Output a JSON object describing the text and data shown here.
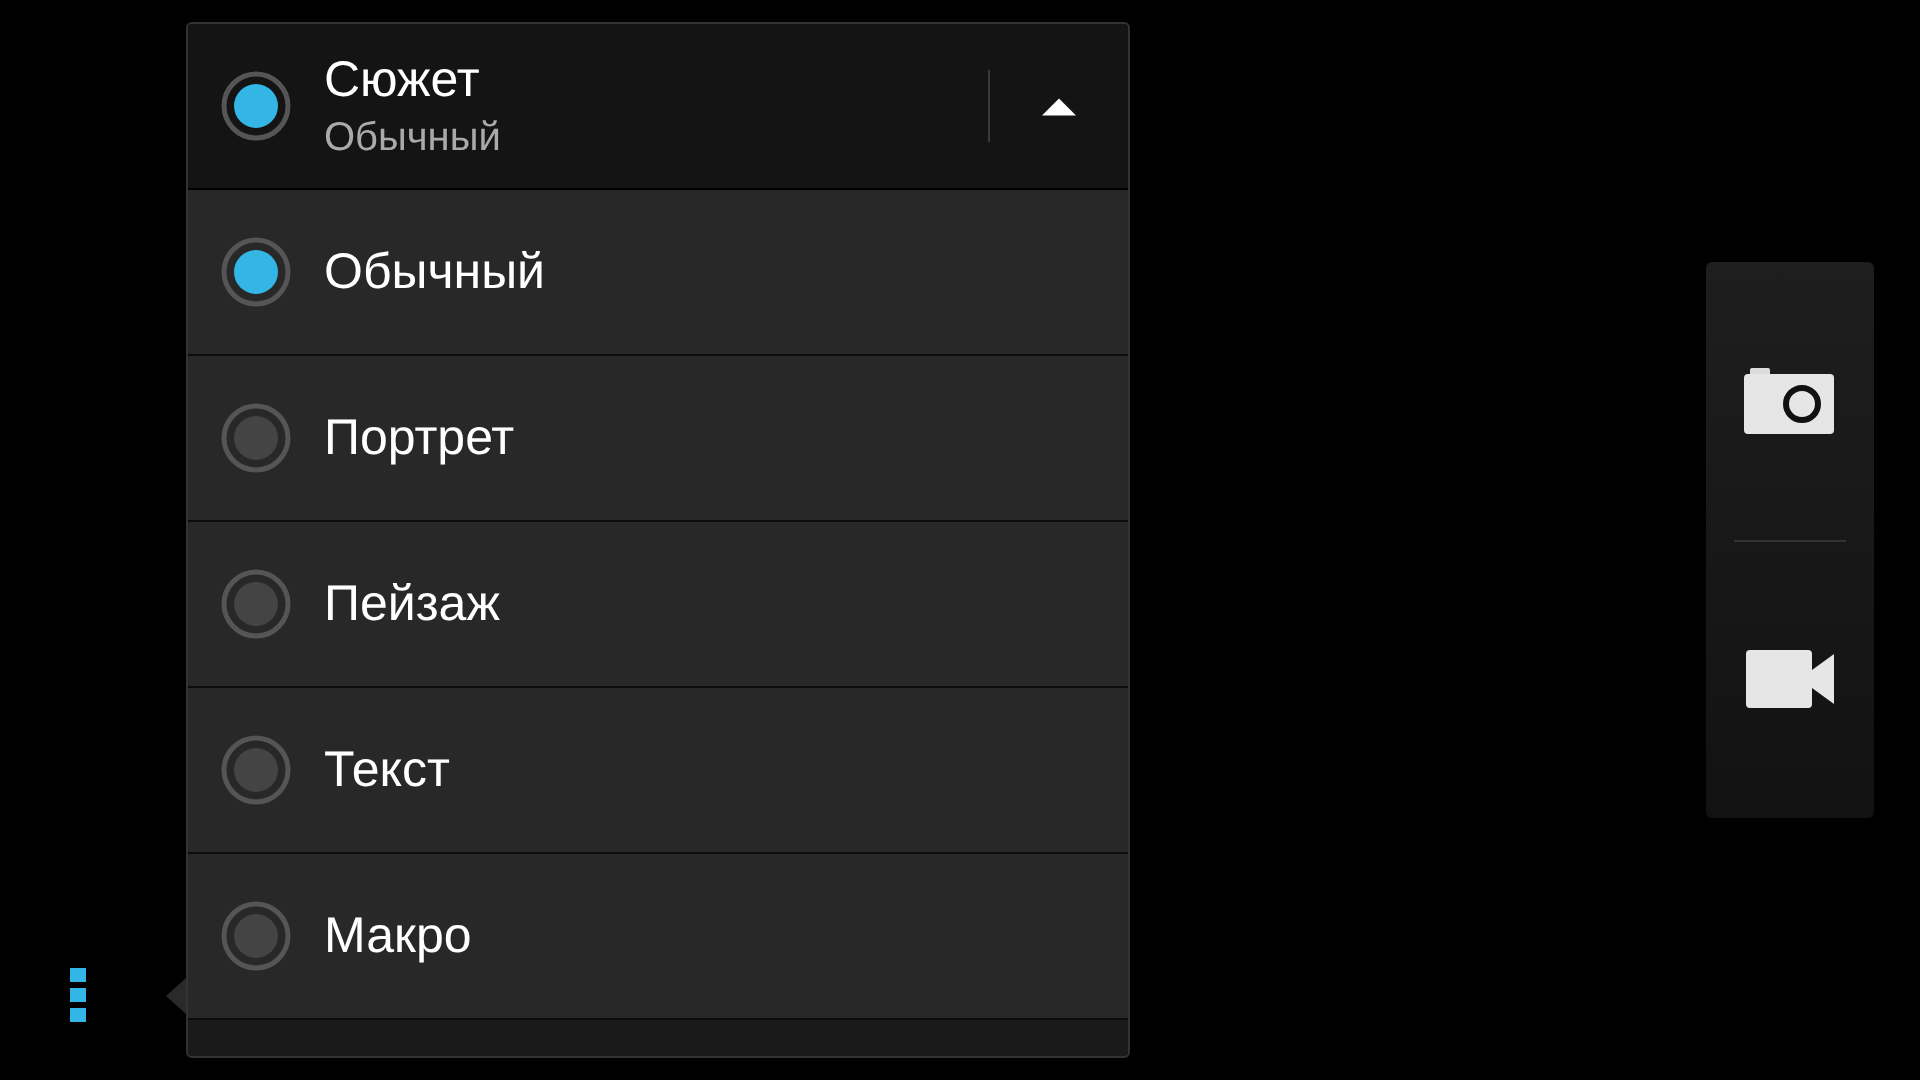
{
  "scene_menu": {
    "title": "Сюжет",
    "value": "Обычный",
    "expanded": true,
    "options": [
      {
        "label": "Обычный",
        "selected": true
      },
      {
        "label": "Портрет",
        "selected": false
      },
      {
        "label": "Пейзаж",
        "selected": false
      },
      {
        "label": "Текст",
        "selected": false
      },
      {
        "label": "Макро",
        "selected": false
      }
    ]
  },
  "mode_switch": {
    "modes": [
      {
        "kind": "photo"
      },
      {
        "kind": "video"
      }
    ]
  }
}
